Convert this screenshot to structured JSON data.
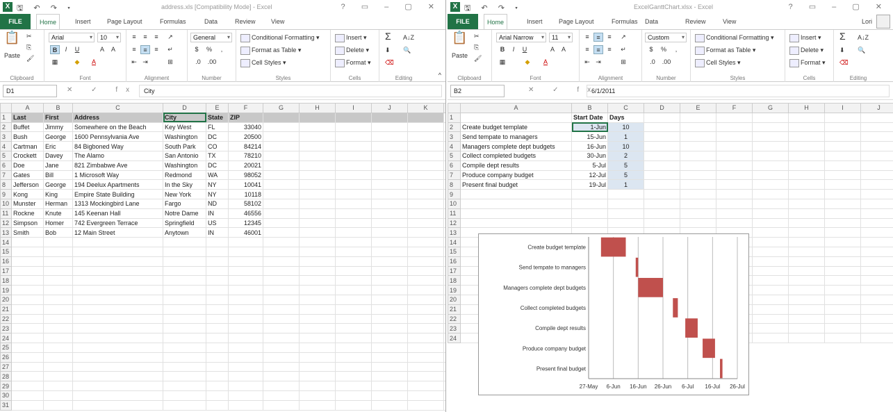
{
  "left": {
    "window_title": "address.xls [Compatibility Mode] - Excel",
    "user": "",
    "tabs": [
      "FILE",
      "Home",
      "Insert",
      "Page Layout",
      "Formulas",
      "Data",
      "Review",
      "View"
    ],
    "ribbon": {
      "font_name": "Arial",
      "font_size": "10",
      "number_format": "General",
      "paste": "Paste",
      "conditional_formatting": "Conditional Formatting",
      "format_as_table": "Format as Table",
      "cell_styles": "Cell Styles",
      "insert": "Insert",
      "delete": "Delete",
      "format": "Format",
      "groups": [
        "Clipboard",
        "Font",
        "Alignment",
        "Number",
        "Styles",
        "Cells",
        "Editing"
      ]
    },
    "name_box": "D1",
    "formula": "City",
    "columns": [
      "A",
      "B",
      "C",
      "D",
      "E",
      "F",
      "G",
      "H",
      "I",
      "J",
      "K"
    ],
    "rows": [
      [
        "Last",
        "First",
        "Address",
        "City",
        "State",
        "ZIP"
      ],
      [
        "Buffet",
        "Jimmy",
        "Somewhere on the Beach",
        "Key West",
        "FL",
        "33040"
      ],
      [
        "Bush",
        "George",
        "1600 Pennsylvania Ave",
        "Washington",
        "DC",
        "20500"
      ],
      [
        "Cartman",
        "Eric",
        "84 Bigboned Way",
        "South Park",
        "CO",
        "84214"
      ],
      [
        "Crockett",
        "Davey",
        "The Alamo",
        "San Antonio",
        "TX",
        "78210"
      ],
      [
        "Doe",
        "Jane",
        "821 Zimbabwe Ave",
        "Washington",
        "DC",
        "20021"
      ],
      [
        "Gates",
        "Bill",
        "1 Microsoft Way",
        "Redmond",
        "WA",
        "98052"
      ],
      [
        "Jefferson",
        "George",
        "194 Deelux Apartments",
        "In the Sky",
        "NY",
        "10041"
      ],
      [
        "Kong",
        "King",
        "Empire State Building",
        "New York",
        "NY",
        "10118"
      ],
      [
        "Munster",
        "Herman",
        "1313 Mockingbird Lane",
        "Fargo",
        "ND",
        "58102"
      ],
      [
        "Rockne",
        "Knute",
        "145 Keenan Hall",
        "Notre Dame",
        "IN",
        "46556"
      ],
      [
        "Simpson",
        "Homer",
        "742 Evergreen Terrace",
        "Springfield",
        "US",
        "12345"
      ],
      [
        "Smith",
        "Bob",
        "12 Main Street",
        "Anytown",
        "IN",
        "46001"
      ]
    ],
    "row_count": 31
  },
  "right": {
    "window_title": "ExcelGanttChart.xlsx - Excel",
    "user": "Lori",
    "tabs": [
      "FILE",
      "Home",
      "Insert",
      "Page Layout",
      "Formulas",
      "Data",
      "Review",
      "View"
    ],
    "ribbon": {
      "font_name": "Arial Narrow",
      "font_size": "11",
      "number_format": "Custom",
      "paste": "Paste",
      "conditional_formatting": "Conditional Formatting",
      "format_as_table": "Format as Table",
      "cell_styles": "Cell Styles",
      "insert": "Insert",
      "delete": "Delete",
      "format": "Format",
      "groups": [
        "Clipboard",
        "Font",
        "Alignment",
        "Number",
        "Styles",
        "Cells",
        "Editing"
      ]
    },
    "name_box": "B2",
    "formula": "6/1/2011",
    "columns": [
      "A",
      "B",
      "C",
      "D",
      "E",
      "F",
      "G",
      "H",
      "I",
      "J"
    ],
    "header_row": [
      "",
      "Start Date",
      "Days"
    ],
    "rows": [
      [
        "Create budget template",
        "1-Jun",
        "10"
      ],
      [
        "Send tempate to managers",
        "15-Jun",
        "1"
      ],
      [
        "Managers complete dept budgets",
        "16-Jun",
        "10"
      ],
      [
        "Collect completed budgets",
        "30-Jun",
        "2"
      ],
      [
        "Compile dept results",
        "5-Jul",
        "5"
      ],
      [
        "Produce company budget",
        "12-Jul",
        "5"
      ],
      [
        "Present final budget",
        "19-Jul",
        "1"
      ]
    ],
    "row_count": 24
  },
  "chart_data": {
    "type": "bar",
    "orientation": "horizontal-gantt",
    "categories": [
      "Create budget template",
      "Send tempate to managers",
      "Managers complete dept budgets",
      "Collect completed budgets",
      "Compile dept results",
      "Produce company budget",
      "Present final budget"
    ],
    "start": [
      "2011-06-01",
      "2011-06-15",
      "2011-06-16",
      "2011-06-30",
      "2011-07-05",
      "2011-07-12",
      "2011-07-19"
    ],
    "days": [
      10,
      1,
      10,
      2,
      5,
      5,
      1
    ],
    "xtick_labels": [
      "27-May",
      "6-Jun",
      "16-Jun",
      "26-Jun",
      "6-Jul",
      "16-Jul",
      "26-Jul"
    ],
    "xlim": [
      "2011-05-27",
      "2011-07-26"
    ],
    "bar_color": "#c0504d",
    "grid": "vertical"
  },
  "colors": {
    "excel_green": "#217346",
    "selection_blue": "#dce6f1",
    "header_gray": "#c8c8c8"
  }
}
